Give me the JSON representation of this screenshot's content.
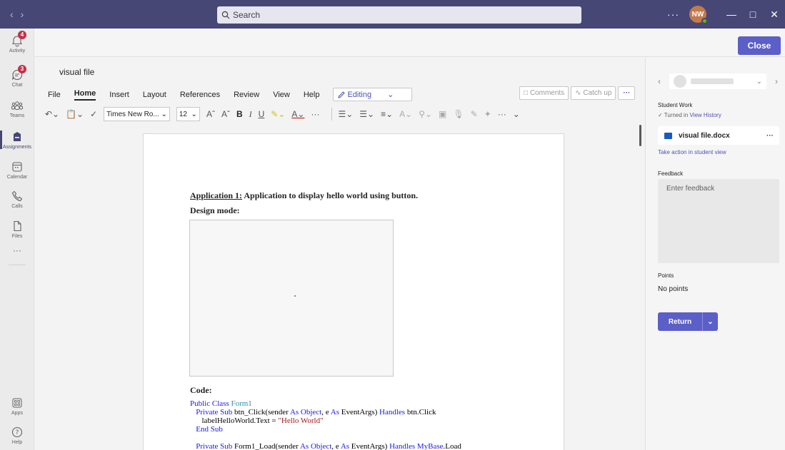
{
  "titlebar": {
    "search_placeholder": "Search",
    "more": "···",
    "avatar_initials": "NW"
  },
  "rail": {
    "items": [
      {
        "label": "Activity",
        "badge": "4"
      },
      {
        "label": "Chat",
        "badge": "3"
      },
      {
        "label": "Teams"
      },
      {
        "label": "Assignments"
      },
      {
        "label": "Calendar"
      },
      {
        "label": "Calls"
      },
      {
        "label": "Files"
      },
      {
        "label": "···"
      },
      {
        "label": "Apps"
      },
      {
        "label": "Help"
      }
    ]
  },
  "topbar": {
    "close_label": "Close"
  },
  "word": {
    "doc_title": "visual file",
    "menu": [
      "File",
      "Home",
      "Insert",
      "Layout",
      "References",
      "Review",
      "View",
      "Help"
    ],
    "editing_label": "Editing",
    "comments_label": "Comments",
    "catchup_label": "Catch up",
    "more_label": "···",
    "font_name": "Times New Ro...",
    "font_size": "12"
  },
  "document": {
    "heading_underlined": "Application 1:",
    "heading_rest": " Application to display hello world using button.",
    "design_label": "Design mode:",
    "code_label": "Code:",
    "code": {
      "l1_kw": "Public Class",
      "l1_cl": " Form1",
      "l2_kw1": "   Private Sub",
      "l2_a": " btn_Click(sender ",
      "l2_kw2": "As Object",
      "l2_b": ", e ",
      "l2_kw3": "As",
      "l2_c": " EventArgs) ",
      "l2_kw4": "Handles",
      "l2_d": " btn.Click",
      "l3_a": "      labelHelloWorld.Text = ",
      "l3_str": "\"Hello World\"",
      "l4_kw": "   End Sub",
      "l6_kw1": "   Private Sub",
      "l6_a": " Form1_Load(sender ",
      "l6_kw2": "As Object",
      "l6_b": ", e ",
      "l6_kw3": "As",
      "l6_c": " EventArgs) ",
      "l6_kw4": "Handles",
      "l6_kw5": " MyBase",
      "l6_d": ".Load"
    }
  },
  "panel": {
    "student_work_label": "Student Work",
    "turned_in_prefix": "Turned in",
    "view_history": "View History",
    "file_name": "visual file.docx",
    "file_more": "···",
    "take_action": "Take action in student view",
    "feedback_label": "Feedback",
    "feedback_placeholder": "Enter feedback",
    "points_label": "Points",
    "points_value": "No points",
    "return_label": "Return"
  },
  "colors": {
    "titlebar": "#464775",
    "accent": "#5b5fc7",
    "badge": "#c4314b"
  }
}
